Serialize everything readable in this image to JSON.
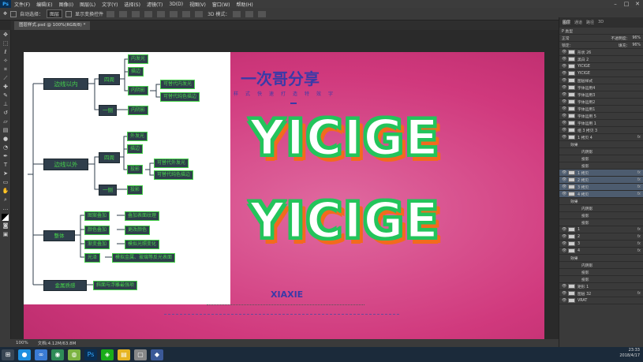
{
  "app": {
    "logo": "Ps",
    "menu": [
      "文件(F)",
      "编辑(E)",
      "图像(I)",
      "图层(L)",
      "文字(Y)",
      "选择(S)",
      "滤镜(T)",
      "3D(D)",
      "视图(V)",
      "窗口(W)",
      "帮助(H)"
    ],
    "doc_tab": "图层样式.psd @ 100%(RGB/8) *"
  },
  "options_bar": {
    "auto_select_label": "自动选择：",
    "auto_select_value": "图层",
    "transform_label": "显示变换控件",
    "mode_3d": "3D 模式："
  },
  "status": {
    "zoom": "100%",
    "doc_info": "文档:4.12M/63.8M"
  },
  "mindmap": {
    "branches": {
      "inner": "边线以内",
      "outer": "边线以外",
      "whole": "整体",
      "metal": "金属质感"
    },
    "inner_four": "四周",
    "inner_one": "一侧",
    "inner_leaves": [
      "内发光",
      "描边",
      "内阴影"
    ],
    "inner_side_leaf": "内阴影",
    "inner_replace": [
      "可替代内发光",
      "可替代纯色描边"
    ],
    "outer_four": "四周",
    "outer_one": "一侧",
    "outer_leaves": [
      "外发光",
      "描边",
      "投影"
    ],
    "outer_side_leaf": "投影",
    "outer_replace": [
      "可替代外发光",
      "可替代纯色描边"
    ],
    "whole_items": [
      "图案叠加",
      "颜色叠加",
      "渐变叠加",
      "光泽"
    ],
    "whole_desc": [
      "叠加表面纹理",
      "更改颜色",
      "模拟光照变化",
      "模拟金属、玻璃等反光表面"
    ],
    "metal_desc": "斜面与浮雕最强项"
  },
  "poster": {
    "title": "一次哥分享",
    "subtitle": "样式快速打造特效字",
    "word1": "YICIGE",
    "word2": "YICIGE",
    "footer": "XIAXIE"
  },
  "layers_panel": {
    "tabs": [
      "图层",
      "通道",
      "路径",
      "3D"
    ],
    "filter": "P 类型",
    "blend_mode": "正常",
    "opacity_label": "不透明度：",
    "opacity": "96%",
    "lock_label": "锁定：",
    "fill_label": "填充：",
    "fill": "96%",
    "rows": [
      {
        "name": "形状 26",
        "fx": ""
      },
      {
        "name": "黑白 2",
        "fx": ""
      },
      {
        "name": "YICIGE",
        "fx": ""
      },
      {
        "name": "YICIGE",
        "fx": ""
      },
      {
        "name": "图层样式",
        "fx": ""
      },
      {
        "name": "字体运用4",
        "fx": ""
      },
      {
        "name": "字体运用3",
        "fx": ""
      },
      {
        "name": "字体运用2",
        "fx": ""
      },
      {
        "name": "字体运用1",
        "fx": ""
      },
      {
        "name": "字体运用 5",
        "fx": ""
      },
      {
        "name": "字体运用 1",
        "fx": ""
      },
      {
        "name": "组 3 拷贝 3",
        "fx": ""
      },
      {
        "name": "1 拷贝 4",
        "fx": "fx"
      },
      {
        "name": "效果",
        "fx": ""
      },
      {
        "name": "内阴影",
        "fx": ""
      },
      {
        "name": "投影",
        "fx": ""
      },
      {
        "name": "投影",
        "fx": ""
      },
      {
        "name": "1 拷贝",
        "fx": "fx"
      },
      {
        "name": "2 拷贝",
        "fx": "fx"
      },
      {
        "name": "3 拷贝",
        "fx": "fx"
      },
      {
        "name": "4 拷贝",
        "fx": "fx"
      },
      {
        "name": "效果",
        "fx": ""
      },
      {
        "name": "内阴影",
        "fx": ""
      },
      {
        "name": "投影",
        "fx": ""
      },
      {
        "name": "投影",
        "fx": ""
      },
      {
        "name": "1",
        "fx": "fx"
      },
      {
        "name": "2",
        "fx": "fx"
      },
      {
        "name": "3",
        "fx": "fx"
      },
      {
        "name": "4",
        "fx": "fx"
      },
      {
        "name": "效果",
        "fx": ""
      },
      {
        "name": "内阴影",
        "fx": ""
      },
      {
        "name": "投影",
        "fx": ""
      },
      {
        "name": "投影",
        "fx": ""
      },
      {
        "name": "矩形 1",
        "fx": ""
      },
      {
        "name": "图层 32",
        "fx": "fx"
      },
      {
        "name": "VRAT",
        "fx": ""
      }
    ]
  },
  "taskbar": {
    "time": "23:33",
    "date": "2018/4/17"
  },
  "colors": {
    "canvas": "#d13f83",
    "accent_green": "#23c45b",
    "accent_orange": "#f26b1d",
    "title_blue": "#3a3aa8"
  }
}
